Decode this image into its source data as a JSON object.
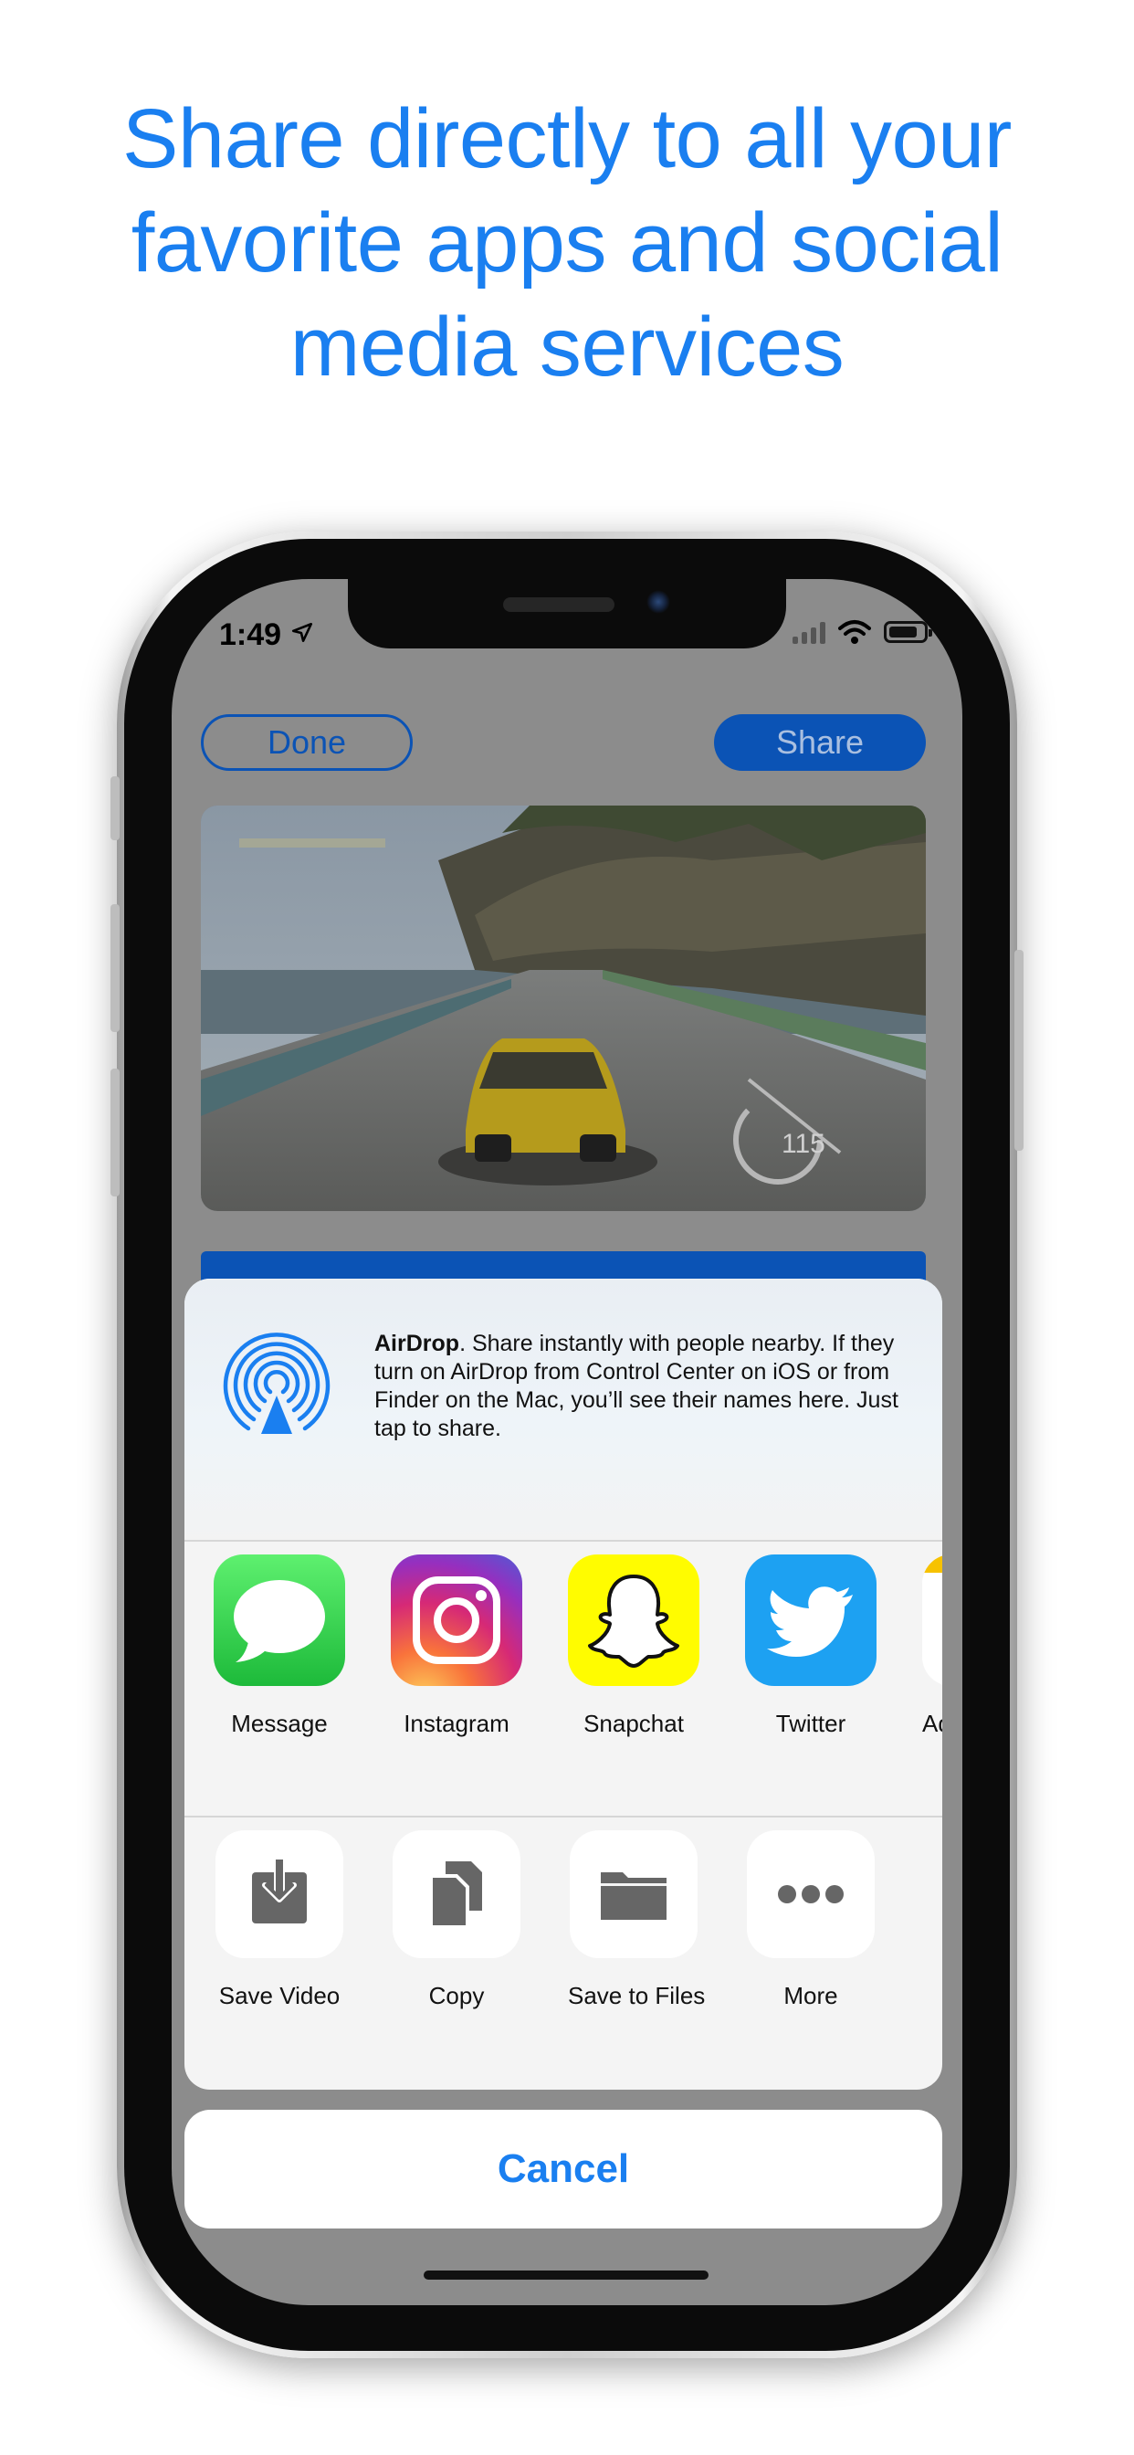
{
  "headline": {
    "lines": [
      "Share directly to all your",
      "favorite apps and social",
      "media services"
    ]
  },
  "status_bar": {
    "time": "1:49"
  },
  "toolbar": {
    "done_label": "Done",
    "share_label": "Share"
  },
  "airdrop": {
    "title": "AirDrop",
    "description": ". Share instantly with people nearby. If they turn on AirDrop from Control Center on iOS or from Finder on the Mac, you’ll see their names here. Just tap to share."
  },
  "apps": [
    {
      "label": "Message",
      "icon": "messages-icon",
      "color": "#2bd34a"
    },
    {
      "label": "Instagram",
      "icon": "instagram-icon",
      "color": "#d62976"
    },
    {
      "label": "Snapchat",
      "icon": "snapchat-icon",
      "color": "#fffc00"
    },
    {
      "label": "Twitter",
      "icon": "twitter-icon",
      "color": "#1da1f2"
    },
    {
      "label": "Ad",
      "icon": "notes-icon",
      "color": "#f7c200"
    }
  ],
  "actions": [
    {
      "label": "Save Video",
      "icon": "save-video-icon"
    },
    {
      "label": "Copy",
      "icon": "copy-icon"
    },
    {
      "label": "Save to Files",
      "icon": "folder-icon"
    },
    {
      "label": "More",
      "icon": "more-icon"
    }
  ],
  "cancel_label": "Cancel",
  "colors": {
    "accent": "#1a7ff0",
    "button_blue": "#0b53b5"
  }
}
